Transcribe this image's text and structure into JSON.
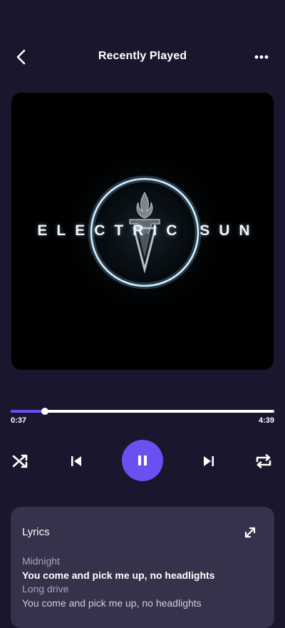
{
  "header": {
    "title": "Recently Played",
    "back_icon": "chevron-left-icon",
    "more_icon": "more-horizontal-icon"
  },
  "album_art": {
    "title": "ELECTRIC SUN"
  },
  "playback": {
    "current_time": "0:37",
    "total_time": "4:39",
    "progress_fraction": 0.13
  },
  "controls": {
    "shuffle_icon": "shuffle-icon",
    "previous_icon": "skip-previous-icon",
    "pause_icon": "pause-icon",
    "next_icon": "skip-next-icon",
    "repeat_icon": "repeat-icon"
  },
  "lyrics": {
    "heading": "Lyrics",
    "expand_icon": "expand-icon",
    "lines": [
      "Midnight",
      "You come and pick me up, no headlights",
      "Long drive",
      "You come and pick me up, no headlights"
    ]
  },
  "colors": {
    "background": "#19172e",
    "accent": "#6b4ff0",
    "card": "#35334b"
  }
}
